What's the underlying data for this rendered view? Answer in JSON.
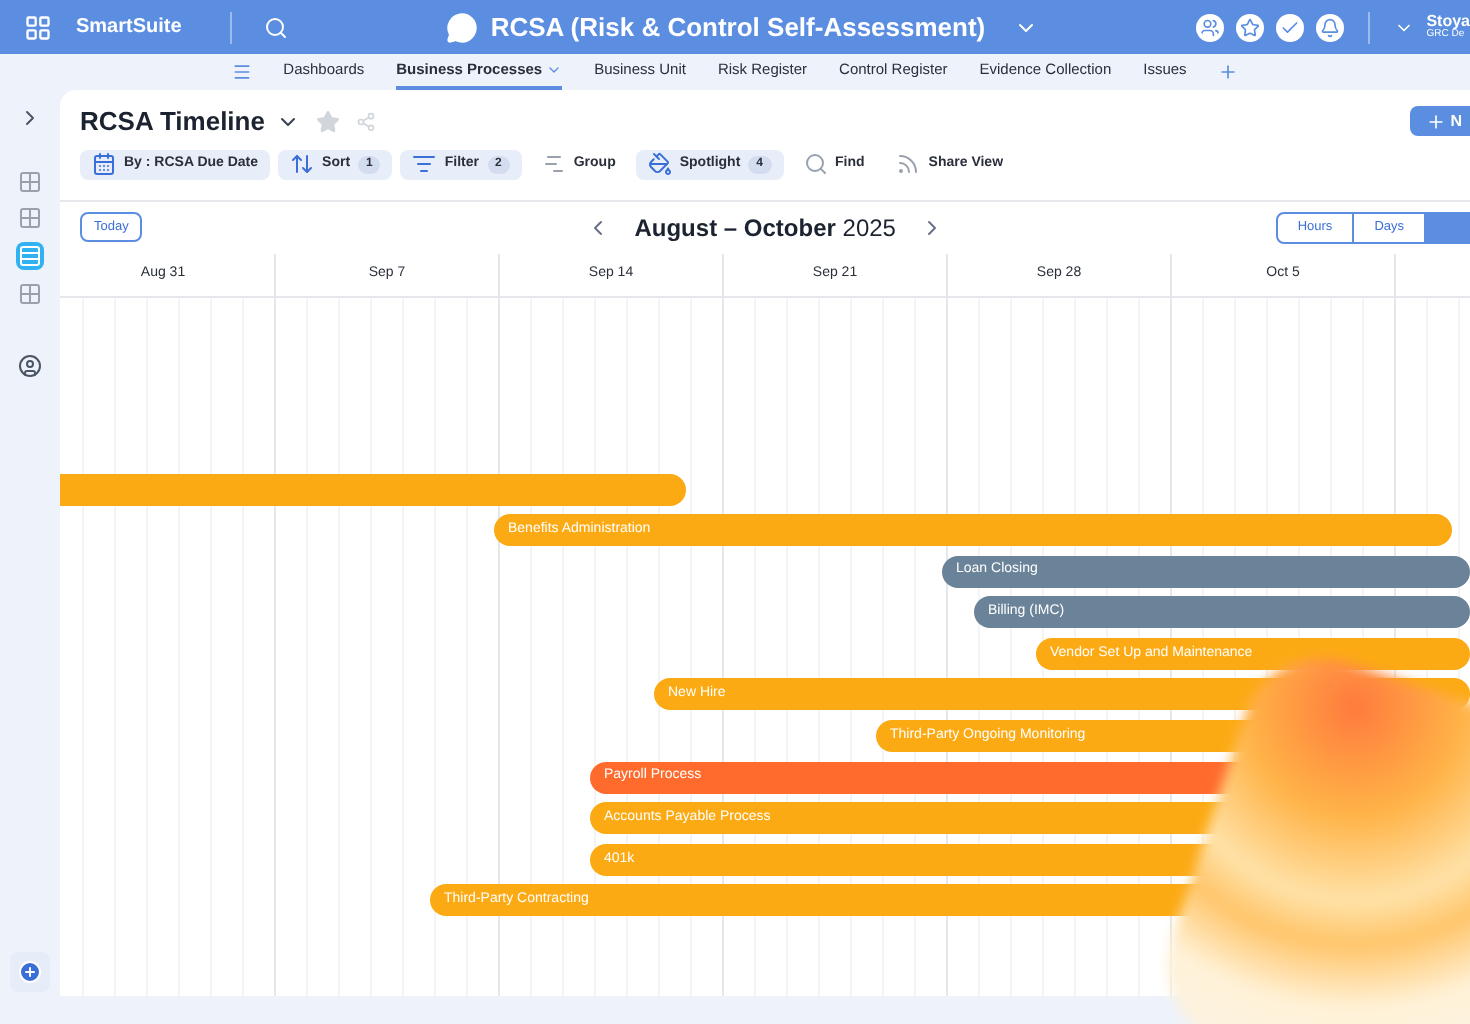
{
  "app": {
    "name": "SmartSuite",
    "title": "RCSA (Risk & Control Self-Assessment)",
    "user_name": "Stoya",
    "user_role": "GRC De"
  },
  "nav_tabs": [
    {
      "label": "Dashboards",
      "selected": false
    },
    {
      "label": "Business Processes",
      "selected": true
    },
    {
      "label": "Business Unit",
      "selected": false
    },
    {
      "label": "Risk Register",
      "selected": false
    },
    {
      "label": "Control Register",
      "selected": false
    },
    {
      "label": "Evidence Collection",
      "selected": false
    },
    {
      "label": "Issues",
      "selected": false
    }
  ],
  "sidebar_items": [
    {
      "selected": false
    },
    {
      "selected": false
    },
    {
      "selected": true
    },
    {
      "selected": false
    }
  ],
  "view": {
    "title": "RCSA Timeline",
    "new_button": "N"
  },
  "toolbar": [
    {
      "kind": "date",
      "label": "By : RCSA Due Date",
      "active": true
    },
    {
      "kind": "sort",
      "label": "Sort",
      "count": "1",
      "active": true
    },
    {
      "kind": "filter",
      "label": "Filter",
      "count": "2",
      "active": true
    },
    {
      "kind": "group",
      "label": "Group",
      "active": false
    },
    {
      "kind": "spotlight",
      "label": "Spotlight",
      "count": "4",
      "active": true
    },
    {
      "kind": "find",
      "label": "Find",
      "active": false
    },
    {
      "kind": "share",
      "label": "Share View",
      "active": false
    }
  ],
  "timeline": {
    "today_button": "Today",
    "range_bold": "August – October",
    "range_year": "2025",
    "view_modes": [
      {
        "label": "Hours",
        "selected": false
      },
      {
        "label": "Days",
        "selected": false
      },
      {
        "selected": true
      }
    ],
    "weeks": [
      "Aug 31",
      "Sep 7",
      "Sep 14",
      "Sep 21",
      "Sep 28",
      "Oct 5"
    ],
    "bars": [
      {
        "color": "#fcaa14"
      },
      {
        "label": "Benefits Administration",
        "color": "#fcaa14"
      },
      {
        "label": "Loan Closing",
        "color": "#6b8399"
      },
      {
        "label": "Billing (IMC)",
        "color": "#6b8399"
      },
      {
        "label": "Vendor Set Up and Maintenance",
        "color": "#fcaa14"
      },
      {
        "label": "New Hire",
        "color": "#fcaa14"
      },
      {
        "label": "Third-Party Ongoing Monitoring",
        "color": "#fcaa14"
      },
      {
        "label": "Payroll Process",
        "color": "#ff6b2c"
      },
      {
        "label": "Accounts Payable Process",
        "color": "#fcaa14"
      },
      {
        "label": "401k",
        "color": "#fcaa14"
      },
      {
        "label": "Third-Party Contracting",
        "color": "#fcaa14"
      }
    ]
  }
}
